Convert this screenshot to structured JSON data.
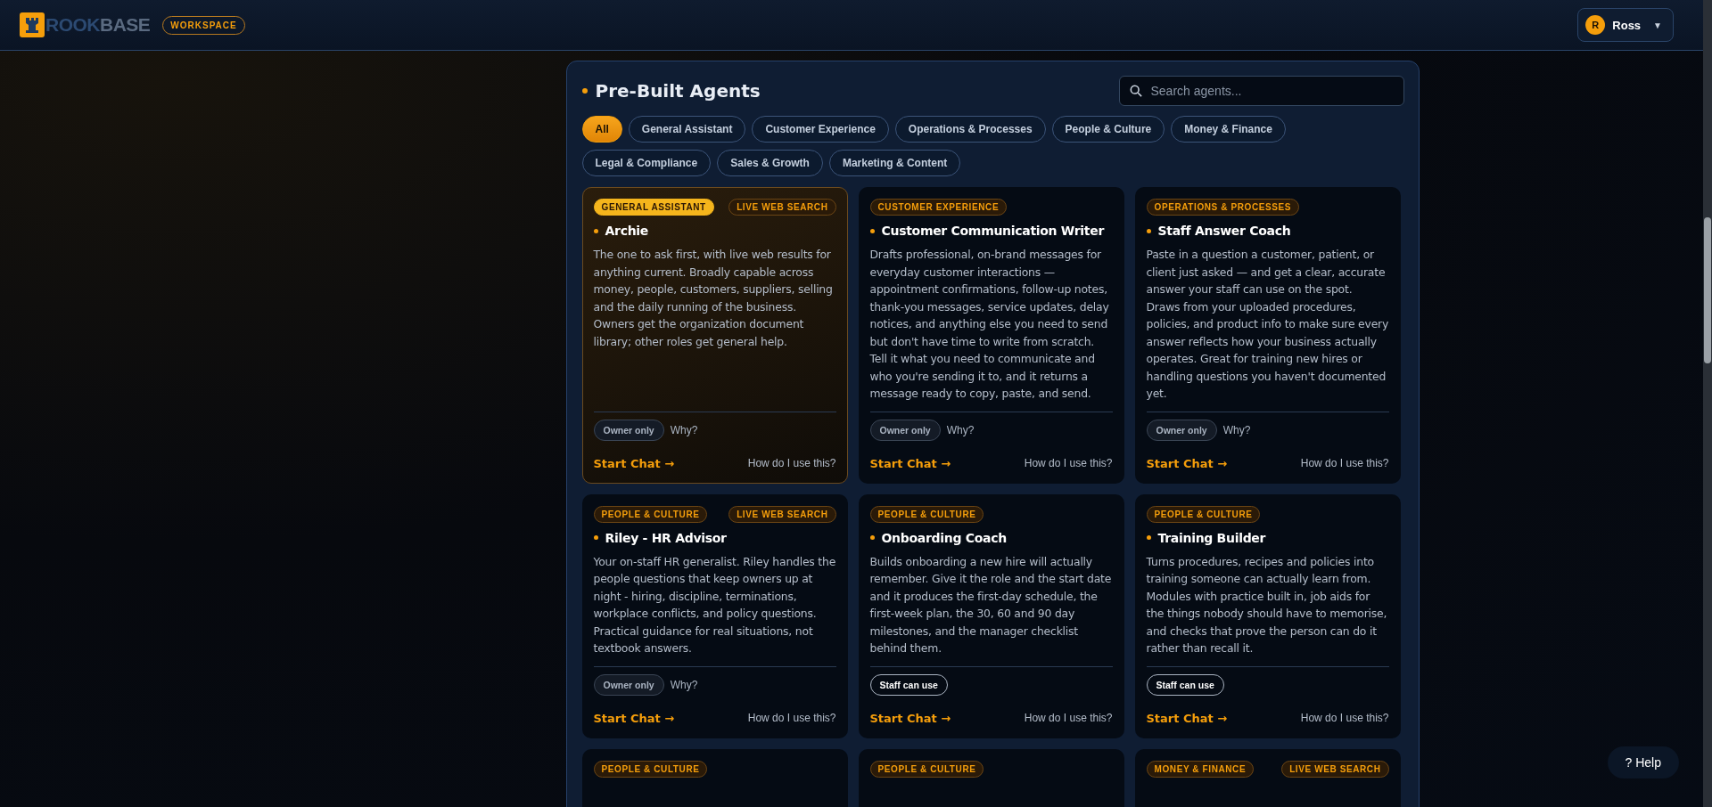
{
  "header": {
    "logo": {
      "part_1": "ROOK",
      "part_2": "BASE"
    },
    "workspace_badge": "WORKSPACE",
    "user": {
      "initial": "R",
      "name": "Ross",
      "caret": "▼"
    }
  },
  "panel": {
    "title": "Pre-Built Agents",
    "search": {
      "placeholder": "Search agents..."
    },
    "filters": [
      {
        "label": "All",
        "selected": true
      },
      {
        "label": "General Assistant",
        "selected": false
      },
      {
        "label": "Customer Experience",
        "selected": false
      },
      {
        "label": "Operations & Processes",
        "selected": false
      },
      {
        "label": "People & Culture",
        "selected": false
      },
      {
        "label": "Money & Finance",
        "selected": false
      },
      {
        "label": "Legal & Compliance",
        "selected": false
      },
      {
        "label": "Sales & Growth",
        "selected": false
      },
      {
        "label": "Marketing & Content",
        "selected": false
      }
    ],
    "agents": [
      {
        "category": "GENERAL ASSISTANT",
        "live_web_search": "LIVE WEB SEARCH",
        "featured": true,
        "name": "Archie",
        "description": "The one to ask first, with live web results for anything current. Broadly capable across money, people, customers, suppliers, selling and the daily running of the business. Owners get the organization document library; other roles get general help.",
        "access": {
          "kind": "owner",
          "label": "Owner only",
          "why": "Why?"
        },
        "start": "Start Chat →",
        "help": "How do I use this?"
      },
      {
        "category": "CUSTOMER EXPERIENCE",
        "featured": false,
        "name": "Customer Communication Writer",
        "description": "Drafts professional, on-brand messages for everyday customer interactions — appointment confirmations, follow-up notes, thank-you messages, service updates, delay notices, and anything else you need to send but don't have time to write from scratch. Tell it what you need to communicate and who you're sending it to, and it returns a message ready to copy, paste, and send.",
        "access": {
          "kind": "owner",
          "label": "Owner only",
          "why": "Why?"
        },
        "start": "Start Chat →",
        "help": "How do I use this?"
      },
      {
        "category": "OPERATIONS & PROCESSES",
        "featured": false,
        "name": "Staff Answer Coach",
        "description": "Paste in a question a customer, patient, or client just asked — and get a clear, accurate answer your staff can use on the spot. Draws from your uploaded procedures, policies, and product info to make sure every answer reflects how your business actually operates. Great for training new hires or handling questions you haven't documented yet.",
        "access": {
          "kind": "owner",
          "label": "Owner only",
          "why": "Why?"
        },
        "start": "Start Chat →",
        "help": "How do I use this?"
      },
      {
        "category": "PEOPLE & CULTURE",
        "live_web_search": "LIVE WEB SEARCH",
        "featured": false,
        "name": "Riley - HR Advisor",
        "description": "Your on-staff HR generalist. Riley handles the people questions that keep owners up at night - hiring, discipline, terminations, workplace conflicts, and policy questions. Practical guidance for real situations, not textbook answers.",
        "access": {
          "kind": "owner",
          "label": "Owner only",
          "why": "Why?"
        },
        "start": "Start Chat →",
        "help": "How do I use this?"
      },
      {
        "category": "PEOPLE & CULTURE",
        "featured": false,
        "name": "Onboarding Coach",
        "description": "Builds onboarding a new hire will actually remember. Give it the role and the start date and it produces the first-day schedule, the first-week plan, the 30, 60 and 90 day milestones, and the manager checklist behind them.",
        "access": {
          "kind": "staff",
          "label": "Staff can use"
        },
        "start": "Start Chat →",
        "help": "How do I use this?"
      },
      {
        "category": "PEOPLE & CULTURE",
        "featured": false,
        "name": "Training Builder",
        "description": "Turns procedures, recipes and policies into training someone can actually learn from. Modules with practice built in, job aids for the things nobody should have to memorise, and checks that prove the person can do it rather than recall it.",
        "access": {
          "kind": "staff",
          "label": "Staff can use"
        },
        "start": "Start Chat →",
        "help": "How do I use this?"
      },
      {
        "category": "PEOPLE & CULTURE",
        "featured": false
      },
      {
        "category": "PEOPLE & CULTURE",
        "featured": false
      },
      {
        "category": "MONEY & FINANCE",
        "live_web_search": "LIVE WEB SEARCH",
        "featured": false
      }
    ]
  },
  "help_button": "? Help"
}
